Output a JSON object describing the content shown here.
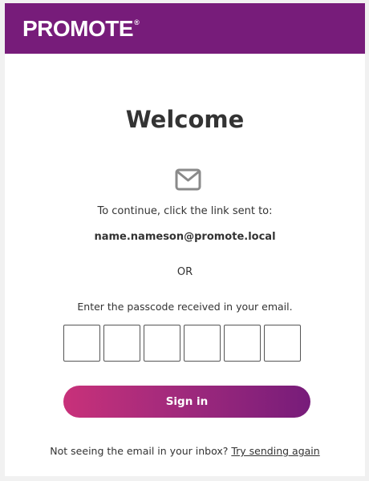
{
  "brand": {
    "name": "PROMOTE",
    "registered_mark": "®",
    "color": "#771c7a"
  },
  "card": {
    "title": "Welcome",
    "icon": "mail-icon",
    "continue_text": "To continue, click the link sent to:",
    "email": "name.nameson@promote.local",
    "or_text": "OR",
    "passcode_prompt": "Enter the passcode received in your email.",
    "passcode_digits": [
      "",
      "",
      "",
      "",
      "",
      ""
    ],
    "signin_label": "Sign in",
    "resend_prefix": "Not seeing the email in your inbox?",
    "resend_link": "Try sending again"
  },
  "colors": {
    "button_gradient_start": "#c8317a",
    "button_gradient_end": "#771c7a",
    "text": "#333333"
  }
}
